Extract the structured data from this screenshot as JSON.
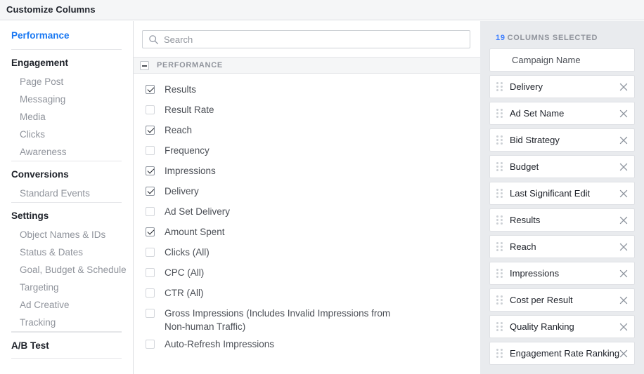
{
  "window": {
    "title": "Customize Columns"
  },
  "sidebar": {
    "top_link": "Performance",
    "groups": [
      {
        "label": "Engagement",
        "items": [
          "Page Post",
          "Messaging",
          "Media",
          "Clicks",
          "Awareness"
        ]
      },
      {
        "label": "Conversions",
        "items": [
          "Standard Events"
        ]
      },
      {
        "label": "Settings",
        "items": [
          "Object Names & IDs",
          "Status & Dates",
          "Goal, Budget & Schedule",
          "Targeting",
          "Ad Creative",
          "Tracking"
        ]
      }
    ],
    "footer_group": "A/B Test"
  },
  "search": {
    "placeholder": "Search",
    "value": "",
    "icon": "search-icon"
  },
  "section": {
    "label": "PERFORMANCE",
    "collapse_icon": "minus-icon",
    "expanded": true
  },
  "columns": [
    {
      "label": "Results",
      "checked": true
    },
    {
      "label": "Result Rate",
      "checked": false
    },
    {
      "label": "Reach",
      "checked": true
    },
    {
      "label": "Frequency",
      "checked": false
    },
    {
      "label": "Impressions",
      "checked": true
    },
    {
      "label": "Delivery",
      "checked": true
    },
    {
      "label": "Ad Set Delivery",
      "checked": false
    },
    {
      "label": "Amount Spent",
      "checked": true
    },
    {
      "label": "Clicks (All)",
      "checked": false
    },
    {
      "label": "CPC (All)",
      "checked": false
    },
    {
      "label": "CTR (All)",
      "checked": false
    },
    {
      "label": "Gross Impressions (Includes Invalid Impressions from Non-human Traffic)",
      "checked": false
    },
    {
      "label": "Auto-Refresh Impressions",
      "checked": false
    }
  ],
  "selected_panel": {
    "count": "19",
    "heading": "COLUMNS SELECTED",
    "rows": [
      {
        "label": "Campaign Name",
        "removable": false,
        "draggable": false
      },
      {
        "label": "Delivery",
        "removable": true,
        "draggable": true
      },
      {
        "label": "Ad Set Name",
        "removable": true,
        "draggable": true
      },
      {
        "label": "Bid Strategy",
        "removable": true,
        "draggable": true
      },
      {
        "label": "Budget",
        "removable": true,
        "draggable": true
      },
      {
        "label": "Last Significant Edit",
        "removable": true,
        "draggable": true
      },
      {
        "label": "Results",
        "removable": true,
        "draggable": true
      },
      {
        "label": "Reach",
        "removable": true,
        "draggable": true
      },
      {
        "label": "Impressions",
        "removable": true,
        "draggable": true
      },
      {
        "label": "Cost per Result",
        "removable": true,
        "draggable": true
      },
      {
        "label": "Quality Ranking",
        "removable": true,
        "draggable": true
      },
      {
        "label": "Engagement Rate Ranking",
        "removable": true,
        "draggable": true
      }
    ]
  },
  "colors": {
    "accent_link": "#1877f2",
    "count_blue": "#4080ff",
    "panel_bg": "#e9ebee",
    "header_bg": "#f5f6f7",
    "muted_text": "#90949c"
  }
}
